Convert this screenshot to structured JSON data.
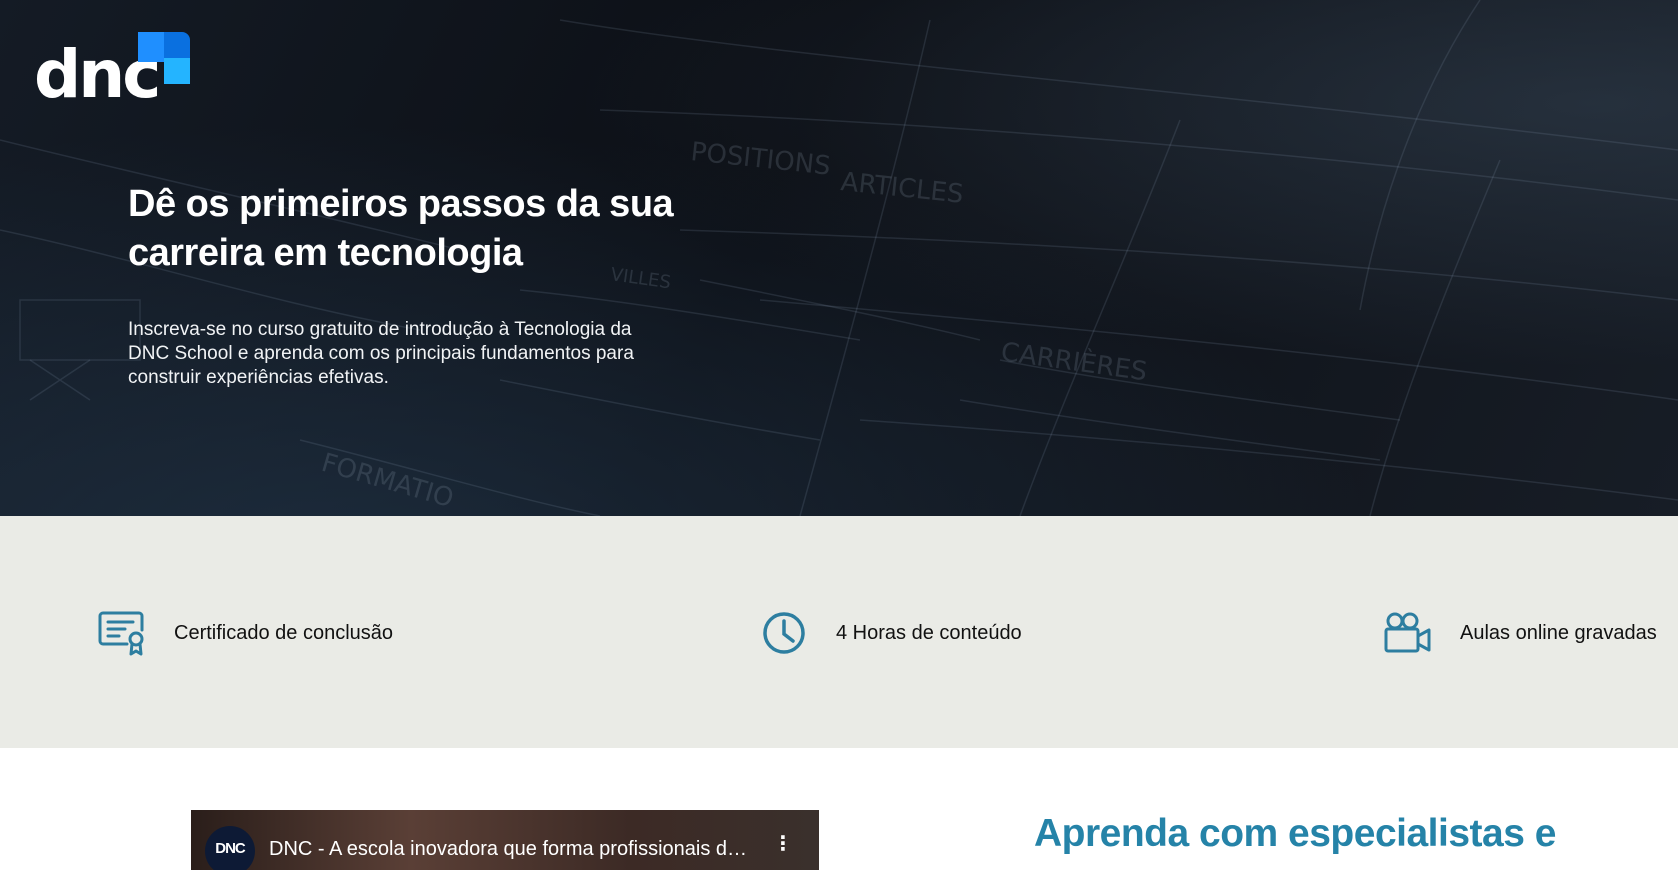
{
  "brand": {
    "logo_text": "dnc",
    "colors": {
      "blue_light": "#24b4ff",
      "blue": "#1f8fff",
      "blue_dark": "#0a70e0"
    }
  },
  "hero": {
    "title": "Dê os primeiros passos da sua carreira em tecnologia",
    "description": "Inscreva-se no curso gratuito de introdução à Tecnologia da DNC School e aprenda com os principais fundamentos para construir experiências efetivas.",
    "background_sketch_words": [
      "POSITIONS",
      "ARTICLES",
      "CARRIÈRES",
      "VILLES",
      "FORMATIO"
    ]
  },
  "features": {
    "icon_color": "#2d7ea0",
    "items": [
      {
        "icon": "certificate-icon",
        "label": "Certificado de conclusão"
      },
      {
        "icon": "clock-icon",
        "label": "4 Horas de conteúdo"
      },
      {
        "icon": "video-camera-icon",
        "label": "Aulas online gravadas"
      }
    ]
  },
  "video": {
    "channel_avatar_text": "DNC",
    "title": "DNC - A escola inovadora que forma profissionais do futuro",
    "menu_icon": "more-vertical-icon"
  },
  "section": {
    "title": "Aprenda com especialistas e",
    "title_color": "#2583a8"
  }
}
